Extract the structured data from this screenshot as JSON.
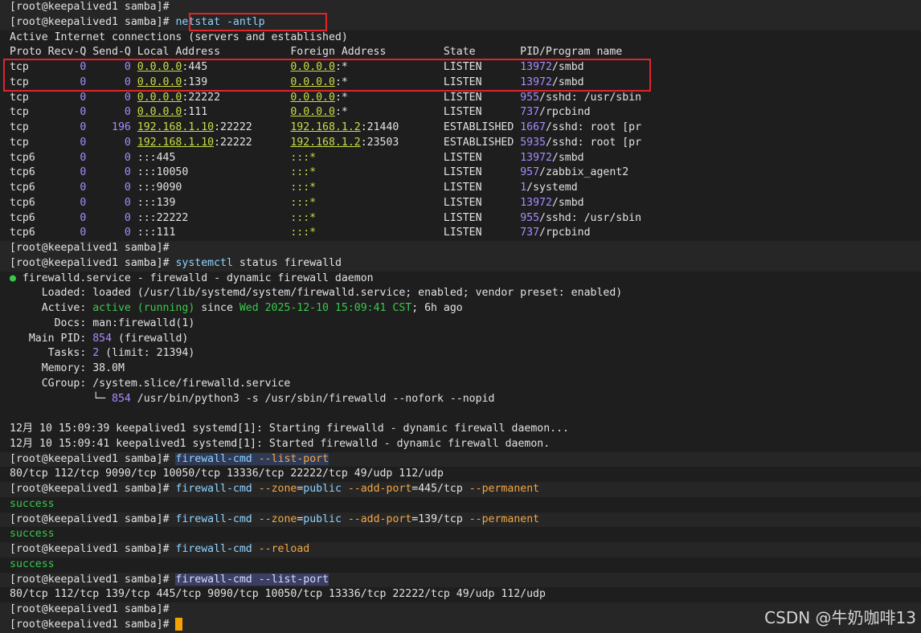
{
  "prompt": "[root@keepalived1 samba]",
  "hash": "#",
  "cmd_netstat": "netstat -antlp",
  "netstat_header1": "Active Internet connections (servers and established)",
  "netstat_header2": "Proto Recv-Q Send-Q Local Address           Foreign Address         State       PID/Program name",
  "netstat_rows": [
    {
      "proto": "tcp  ",
      "recvq": "0",
      "sendq": "0",
      "local_ip": "0.0.0.0",
      "local_port": ":445",
      "foreign": "0.0.0.0:*",
      "state": "LISTEN     ",
      "pid": "13972",
      "prog": "/smbd"
    },
    {
      "proto": "tcp  ",
      "recvq": "0",
      "sendq": "0",
      "local_ip": "0.0.0.0",
      "local_port": ":139",
      "foreign": "0.0.0.0:*",
      "state": "LISTEN     ",
      "pid": "13972",
      "prog": "/smbd"
    },
    {
      "proto": "tcp  ",
      "recvq": "0",
      "sendq": "0",
      "local_ip": "0.0.0.0",
      "local_port": ":22222",
      "foreign": "0.0.0.0:*",
      "state": "LISTEN     ",
      "pid": "955",
      "prog": "/sshd: /usr/sbin"
    },
    {
      "proto": "tcp  ",
      "recvq": "0",
      "sendq": "0",
      "local_ip": "0.0.0.0",
      "local_port": ":111",
      "foreign": "0.0.0.0:*",
      "state": "LISTEN     ",
      "pid": "737",
      "prog": "/rpcbind"
    },
    {
      "proto": "tcp  ",
      "recvq": "0",
      "sendq": "196",
      "local_ip": "192.168.1.10",
      "local_port": ":22222",
      "foreign": "192.168.1.2:21440",
      "state": "ESTABLISHED",
      "pid": "1667",
      "prog": "/sshd: root [pr"
    },
    {
      "proto": "tcp  ",
      "recvq": "0",
      "sendq": "0",
      "local_ip": "192.168.1.10",
      "local_port": ":22222",
      "foreign": "192.168.1.2:23503",
      "state": "ESTABLISHED",
      "pid": "5935",
      "prog": "/sshd: root [pr"
    },
    {
      "proto": "tcp6 ",
      "recvq": "0",
      "sendq": "0",
      "local_ip": ":::445",
      "local_port": "",
      "foreign": ":::*",
      "state": "LISTEN     ",
      "pid": "13972",
      "prog": "/smbd"
    },
    {
      "proto": "tcp6 ",
      "recvq": "0",
      "sendq": "0",
      "local_ip": ":::10050",
      "local_port": "",
      "foreign": ":::*",
      "state": "LISTEN     ",
      "pid": "957",
      "prog": "/zabbix_agent2"
    },
    {
      "proto": "tcp6 ",
      "recvq": "0",
      "sendq": "0",
      "local_ip": ":::9090",
      "local_port": "",
      "foreign": ":::*",
      "state": "LISTEN     ",
      "pid": "1",
      "prog": "/systemd"
    },
    {
      "proto": "tcp6 ",
      "recvq": "0",
      "sendq": "0",
      "local_ip": ":::139",
      "local_port": "",
      "foreign": ":::*",
      "state": "LISTEN     ",
      "pid": "13972",
      "prog": "/smbd"
    },
    {
      "proto": "tcp6 ",
      "recvq": "0",
      "sendq": "0",
      "local_ip": ":::22222",
      "local_port": "",
      "foreign": ":::*",
      "state": "LISTEN     ",
      "pid": "955",
      "prog": "/sshd: /usr/sbin"
    },
    {
      "proto": "tcp6 ",
      "recvq": "0",
      "sendq": "0",
      "local_ip": ":::111",
      "local_port": "",
      "foreign": ":::*",
      "state": "LISTEN     ",
      "pid": "737",
      "prog": "/rpcbind"
    }
  ],
  "cmd_systemctl": "systemctl",
  "cmd_systemctl_args": " status firewalld",
  "svc": {
    "dot": "●",
    "title": " firewalld.service - firewalld - dynamic firewall daemon",
    "loaded_label": "     Loaded:",
    "loaded_value": " loaded (/usr/lib/systemd/system/firewalld.service; enabled; vendor preset: enabled)",
    "active_label": "     Active:",
    "active_value": " active (running)",
    "active_since": " since ",
    "active_date": "Wed 2025-12-10 15:09:41 CST",
    "active_ago": "; 6h ago",
    "docs_label": "       Docs:",
    "docs_value": " man:firewalld(1)",
    "pid_label": "   Main PID:",
    "pid_num": " 854",
    "pid_name": " (firewalld)",
    "tasks_label": "      Tasks:",
    "tasks_num": " 2",
    "tasks_limit": " (limit: 21394)",
    "memory_label": "     Memory:",
    "memory_value": " 38.0M",
    "cgroup_label": "     CGroup:",
    "cgroup_value": " /system.slice/firewalld.service",
    "tree_branch": "             └─",
    "tree_pid": " 854",
    "tree_cmd": " /usr/bin/python3 -s /usr/sbin/firewalld --nofork --nopid"
  },
  "log1": "12月 10 15:09:39 keepalived1 systemd[1]: Starting firewalld - dynamic firewall daemon...",
  "log2": "12月 10 15:09:41 keepalived1 systemd[1]: Started firewalld - dynamic firewall daemon.",
  "fw_cmd": "firewall-cmd",
  "fw_list_opt": " --list-port",
  "fw_list_result1": "80/tcp 112/tcp 9090/tcp 10050/tcp 13336/tcp 22222/tcp 49/udp 112/udp",
  "fw_zone_opt": " --zone",
  "fw_zone_val": "public",
  "fw_add_opt": " --add-port",
  "fw_port445": "445/tcp",
  "fw_port139": "139/tcp",
  "fw_perm": " --permanent",
  "fw_reload": " --reload",
  "success": "success",
  "fw_list_result2": "80/tcp 112/tcp 139/tcp 445/tcp 9090/tcp 10050/tcp 13336/tcp 22222/tcp 49/udp 112/udp",
  "watermark": "CSDN @牛奶咖啡13",
  "colors": {
    "background": "#1e1e1e",
    "highlight_box": "#e0252b",
    "cursor": "#f5a300"
  }
}
